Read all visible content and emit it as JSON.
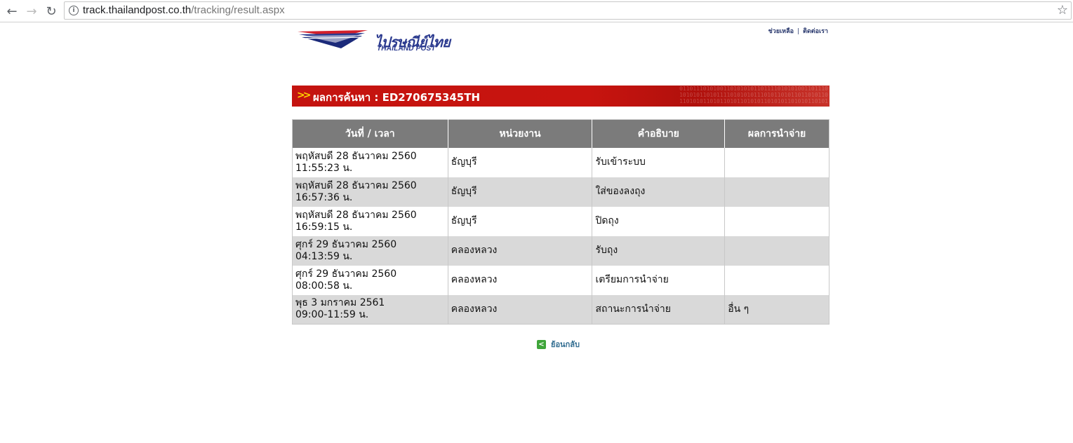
{
  "browser": {
    "url_host": "track.thailandpost.co.th",
    "url_path": "/tracking/result.aspx"
  },
  "header": {
    "logo_th": "ไปรษณีย์ไทย",
    "logo_en": "THAILAND POST",
    "links": [
      "ช่วยเหลือ",
      "ติดต่อเรา"
    ]
  },
  "result": {
    "title": "ผลการค้นหา : ED270675345TH"
  },
  "table": {
    "headers": [
      "วันที่ / เวลา",
      "หน่วยงาน",
      "คำอธิบาย",
      "ผลการนำจ่าย"
    ],
    "rows": [
      {
        "date": "พฤหัสบดี 28 ธันวาคม 2560",
        "time": "11:55:23 น.",
        "unit": "ธัญบุรี",
        "desc": "รับเข้าระบบ",
        "result": ""
      },
      {
        "date": "พฤหัสบดี 28 ธันวาคม 2560",
        "time": "16:57:36 น.",
        "unit": "ธัญบุรี",
        "desc": "ใส่ของลงถุง",
        "result": ""
      },
      {
        "date": "พฤหัสบดี 28 ธันวาคม 2560",
        "time": "16:59:15 น.",
        "unit": "ธัญบุรี",
        "desc": "ปิดถุง",
        "result": ""
      },
      {
        "date": "ศุกร์ 29 ธันวาคม 2560",
        "time": "04:13:59 น.",
        "unit": "คลองหลวง",
        "desc": "รับถุง",
        "result": ""
      },
      {
        "date": "ศุกร์ 29 ธันวาคม 2560",
        "time": "08:00:58 น.",
        "unit": "คลองหลวง",
        "desc": "เตรียมการนำจ่าย",
        "result": ""
      },
      {
        "date": "พุธ 3 มกราคม 2561",
        "time": "09:00-11:59 น.",
        "unit": "คลองหลวง",
        "desc": "สถานะการนำจ่าย",
        "result": "อื่น ๆ"
      }
    ]
  },
  "footer": {
    "back_label": "ย้อนกลับ"
  },
  "colors": {
    "title_bar": "#c4130f",
    "header_bg": "#7b7b7b",
    "row_alt": "#d9d9d9",
    "brand_blue": "#2b3a8f"
  }
}
